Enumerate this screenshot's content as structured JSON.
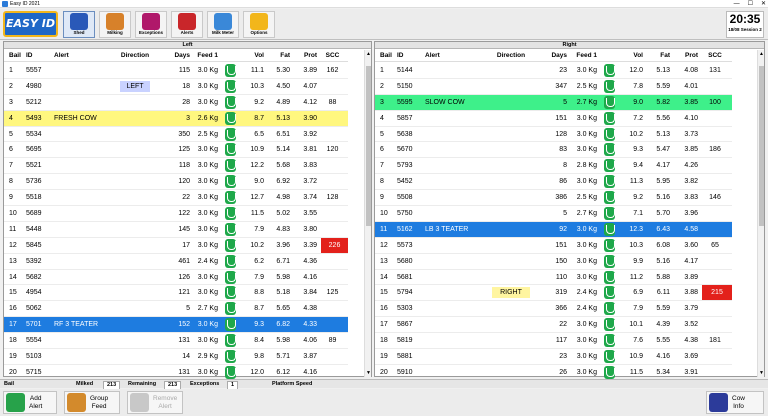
{
  "app": {
    "title": "Easy ID 2021",
    "logo": "EASY ID",
    "win": [
      "—",
      "☐",
      "✕"
    ]
  },
  "toolbar": [
    {
      "label": "Shed",
      "icon": "shed-icon",
      "color": "#2a59b8",
      "active": true
    },
    {
      "label": "Milking",
      "icon": "cow-icon",
      "color": "#d7812a"
    },
    {
      "label": "Exceptions",
      "icon": "exceptions-icon",
      "color": "#b0186a"
    },
    {
      "label": "Alerts",
      "icon": "alerts-icon",
      "color": "#c9262a"
    },
    {
      "label": "Milk Meter",
      "icon": "milk-meter-icon",
      "color": "#3a88d8"
    },
    {
      "label": "Options",
      "icon": "options-icon",
      "color": "#f2b61b"
    }
  ],
  "clock": {
    "time": "20:35",
    "session": "18/08 Session 2"
  },
  "columns": {
    "bail": "Bail",
    "id": "ID",
    "alert": "Alert",
    "direction": "Direction",
    "days": "Days",
    "feed": "Feed 1",
    "vol": "Vol",
    "fat": "Fat",
    "prot": "Prot",
    "scc": "SCC"
  },
  "left": {
    "title": "Left",
    "rows": [
      [
        "1",
        "5557",
        "",
        "",
        "115",
        "3.0 Kg",
        "11.1",
        "5.30",
        "3.89",
        "162",
        ""
      ],
      [
        "2",
        "4980",
        "",
        "LEFT",
        "18",
        "3.0 Kg",
        "10.3",
        "4.50",
        "4.07",
        "",
        ""
      ],
      [
        "3",
        "5212",
        "",
        "",
        "28",
        "3.0 Kg",
        "9.2",
        "4.89",
        "4.12",
        "88",
        ""
      ],
      [
        "4",
        "5493",
        "FRESH COW",
        "",
        "3",
        "2.6 Kg",
        "8.7",
        "5.13",
        "3.90",
        "",
        "yellow"
      ],
      [
        "5",
        "5534",
        "",
        "",
        "350",
        "2.5 Kg",
        "6.5",
        "6.51",
        "3.92",
        "",
        ""
      ],
      [
        "6",
        "5695",
        "",
        "",
        "125",
        "3.0 Kg",
        "10.9",
        "5.14",
        "3.81",
        "120",
        ""
      ],
      [
        "7",
        "5521",
        "",
        "",
        "118",
        "3.0 Kg",
        "12.2",
        "5.68",
        "3.83",
        "",
        ""
      ],
      [
        "8",
        "5736",
        "",
        "",
        "120",
        "3.0 Kg",
        "9.0",
        "6.92",
        "3.72",
        "",
        ""
      ],
      [
        "9",
        "5518",
        "",
        "",
        "22",
        "3.0 Kg",
        "12.7",
        "4.98",
        "3.74",
        "128",
        ""
      ],
      [
        "10",
        "5689",
        "",
        "",
        "122",
        "3.0 Kg",
        "11.5",
        "5.02",
        "3.55",
        "",
        ""
      ],
      [
        "11",
        "5448",
        "",
        "",
        "145",
        "3.0 Kg",
        "7.9",
        "4.83",
        "3.80",
        "",
        ""
      ],
      [
        "12",
        "5845",
        "",
        "",
        "17",
        "3.0 Kg",
        "10.2",
        "3.96",
        "3.39",
        "226",
        ""
      ],
      [
        "13",
        "5392",
        "",
        "",
        "461",
        "2.4 Kg",
        "6.2",
        "6.71",
        "4.36",
        "",
        ""
      ],
      [
        "14",
        "5682",
        "",
        "",
        "126",
        "3.0 Kg",
        "7.9",
        "5.98",
        "4.16",
        "",
        ""
      ],
      [
        "15",
        "4954",
        "",
        "",
        "121",
        "3.0 Kg",
        "8.8",
        "5.18",
        "3.84",
        "125",
        ""
      ],
      [
        "16",
        "5062",
        "",
        "",
        "5",
        "2.7 Kg",
        "8.7",
        "5.65",
        "4.38",
        "",
        ""
      ],
      [
        "17",
        "5701",
        "RF 3 TEATER",
        "",
        "152",
        "3.0 Kg",
        "9.3",
        "6.82",
        "4.33",
        "",
        "blue"
      ],
      [
        "18",
        "5554",
        "",
        "",
        "131",
        "3.0 Kg",
        "8.4",
        "5.98",
        "4.06",
        "89",
        ""
      ],
      [
        "19",
        "5103",
        "",
        "",
        "14",
        "2.9 Kg",
        "9.8",
        "5.71",
        "3.87",
        "",
        ""
      ],
      [
        "20",
        "5715",
        "",
        "",
        "131",
        "3.0 Kg",
        "12.0",
        "6.12",
        "4.16",
        "",
        ""
      ]
    ]
  },
  "right": {
    "title": "Right",
    "rows": [
      [
        "1",
        "5144",
        "",
        "",
        "23",
        "3.0 Kg",
        "12.0",
        "5.13",
        "4.08",
        "131",
        ""
      ],
      [
        "2",
        "5150",
        "",
        "",
        "347",
        "2.5 Kg",
        "7.8",
        "5.59",
        "4.01",
        "",
        ""
      ],
      [
        "3",
        "5595",
        "SLOW COW",
        "",
        "5",
        "2.7 Kg",
        "9.0",
        "5.82",
        "3.85",
        "100",
        "green"
      ],
      [
        "4",
        "5857",
        "",
        "",
        "151",
        "3.0 Kg",
        "7.2",
        "5.56",
        "4.10",
        "",
        ""
      ],
      [
        "5",
        "5638",
        "",
        "",
        "128",
        "3.0 Kg",
        "10.2",
        "5.13",
        "3.73",
        "",
        ""
      ],
      [
        "6",
        "5670",
        "",
        "",
        "83",
        "3.0 Kg",
        "9.3",
        "5.47",
        "3.85",
        "186",
        ""
      ],
      [
        "7",
        "5793",
        "",
        "",
        "8",
        "2.8 Kg",
        "9.4",
        "4.17",
        "4.26",
        "",
        ""
      ],
      [
        "8",
        "5452",
        "",
        "",
        "86",
        "3.0 Kg",
        "11.3",
        "5.95",
        "3.82",
        "",
        ""
      ],
      [
        "9",
        "5508",
        "",
        "",
        "386",
        "2.5 Kg",
        "9.2",
        "5.16",
        "3.83",
        "146",
        ""
      ],
      [
        "10",
        "5750",
        "",
        "",
        "5",
        "2.7 Kg",
        "7.1",
        "5.70",
        "3.96",
        "",
        ""
      ],
      [
        "11",
        "5162",
        "LB 3 TEATER",
        "",
        "92",
        "3.0 Kg",
        "12.3",
        "6.43",
        "4.58",
        "",
        "blue"
      ],
      [
        "12",
        "5573",
        "",
        "",
        "151",
        "3.0 Kg",
        "10.3",
        "6.08",
        "3.60",
        "65",
        ""
      ],
      [
        "13",
        "5680",
        "",
        "",
        "150",
        "3.0 Kg",
        "9.9",
        "5.16",
        "4.17",
        "",
        ""
      ],
      [
        "14",
        "5681",
        "",
        "",
        "110",
        "3.0 Kg",
        "11.2",
        "5.88",
        "3.89",
        "",
        ""
      ],
      [
        "15",
        "5794",
        "",
        "RIGHT",
        "319",
        "2.4 Kg",
        "6.9",
        "6.11",
        "3.88",
        "215",
        ""
      ],
      [
        "16",
        "5303",
        "",
        "",
        "366",
        "2.4 Kg",
        "7.9",
        "5.59",
        "3.79",
        "",
        ""
      ],
      [
        "17",
        "5867",
        "",
        "",
        "22",
        "3.0 Kg",
        "10.1",
        "4.39",
        "3.52",
        "",
        ""
      ],
      [
        "18",
        "5819",
        "",
        "",
        "117",
        "3.0 Kg",
        "7.6",
        "5.55",
        "4.38",
        "181",
        ""
      ],
      [
        "19",
        "5881",
        "",
        "",
        "23",
        "3.0 Kg",
        "10.9",
        "4.16",
        "3.69",
        "",
        ""
      ],
      [
        "20",
        "5910",
        "",
        "",
        "26",
        "3.0 Kg",
        "11.5",
        "5.34",
        "3.91",
        "",
        ""
      ]
    ]
  },
  "status": {
    "bail": "Bail",
    "milked_label": "Milked",
    "milked": "213",
    "remaining_label": "Remaining",
    "remaining": "213",
    "exceptions_label": "Exceptions",
    "exceptions": "1",
    "platform_label": "Platform Speed"
  },
  "bottom": {
    "add_alert": [
      "Add",
      "Alert"
    ],
    "group_feed": [
      "Group",
      "Feed"
    ],
    "disabled": [
      "Remove",
      "Alert"
    ],
    "cow_info": [
      "Cow",
      "Info"
    ]
  },
  "colors": {
    "alert_red": "#e3211b",
    "highlight_blue": "#1e7ce0",
    "highlight_yellow": "#fff77f",
    "highlight_green": "#3ef08a",
    "milk_icon": "#1ea84a"
  }
}
